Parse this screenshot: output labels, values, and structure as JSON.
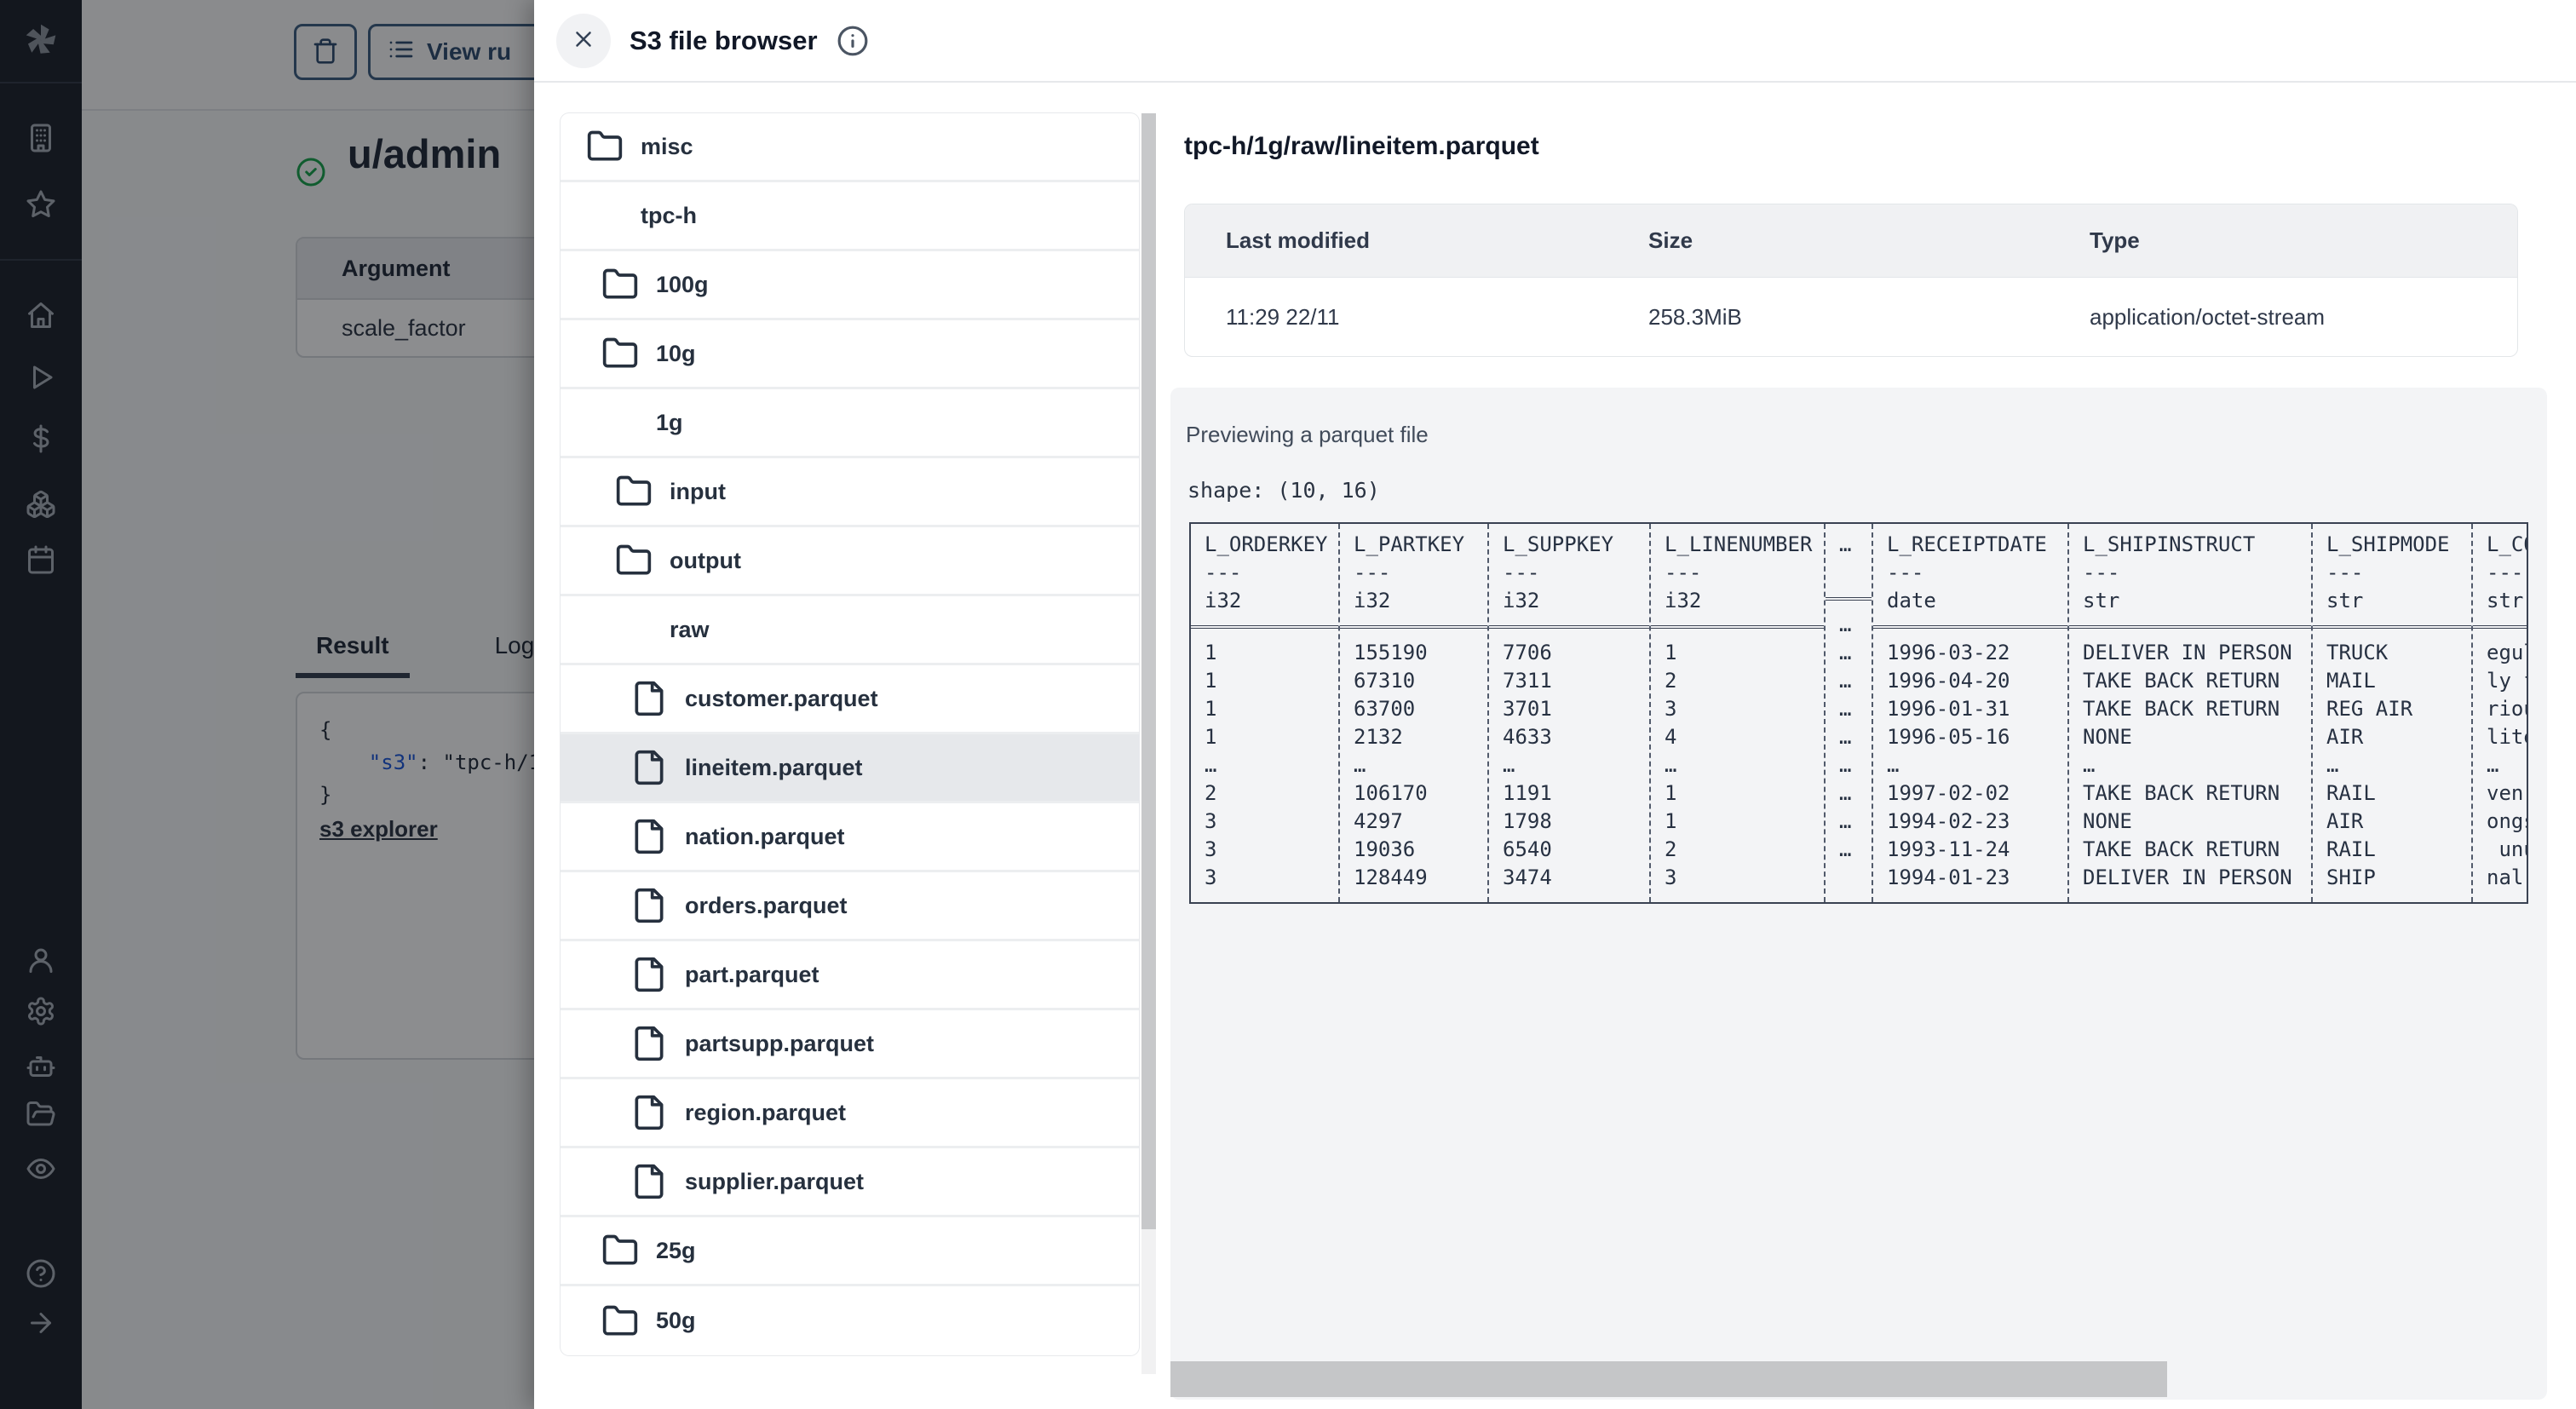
{
  "sidebar": {
    "icons": [
      "windmill-logo",
      "building-icon",
      "star-icon",
      "home-icon",
      "play-icon",
      "dollar-icon",
      "boxes-icon",
      "calendar-icon",
      "user-icon",
      "gear-icon",
      "robot-icon",
      "folder-open-icon",
      "eye-icon",
      "help-icon",
      "arrow-right-icon"
    ]
  },
  "page": {
    "view_runs_label": "View ru",
    "title": "u/admin",
    "arg_table": {
      "header": "Argument",
      "rows": [
        "scale_factor"
      ]
    },
    "tabs": {
      "result": "Result",
      "logs": "Logs"
    },
    "code": {
      "line_open": "{",
      "key": "\"s3\"",
      "sep": ": ",
      "value": "\"tpc-h/1",
      "line_close": "}",
      "link": "s3 explorer"
    }
  },
  "modal": {
    "title": "S3 file browser",
    "tree": {
      "items": [
        {
          "label": "misc",
          "icon": "folder",
          "level": 0,
          "selected": false
        },
        {
          "label": "tpc-h",
          "icon": "folder-open",
          "level": 0,
          "selected": false
        },
        {
          "label": "100g",
          "icon": "folder",
          "level": 1,
          "selected": false
        },
        {
          "label": "10g",
          "icon": "folder",
          "level": 1,
          "selected": false
        },
        {
          "label": "1g",
          "icon": "folder-open",
          "level": 1,
          "selected": false
        },
        {
          "label": "input",
          "icon": "folder",
          "level": 2,
          "selected": false
        },
        {
          "label": "output",
          "icon": "folder",
          "level": 2,
          "selected": false
        },
        {
          "label": "raw",
          "icon": "folder-open",
          "level": 2,
          "selected": false
        },
        {
          "label": "customer.parquet",
          "icon": "file",
          "level": 3,
          "selected": false
        },
        {
          "label": "lineitem.parquet",
          "icon": "file",
          "level": 3,
          "selected": true
        },
        {
          "label": "nation.parquet",
          "icon": "file",
          "level": 3,
          "selected": false
        },
        {
          "label": "orders.parquet",
          "icon": "file",
          "level": 3,
          "selected": false
        },
        {
          "label": "part.parquet",
          "icon": "file",
          "level": 3,
          "selected": false
        },
        {
          "label": "partsupp.parquet",
          "icon": "file",
          "level": 3,
          "selected": false
        },
        {
          "label": "region.parquet",
          "icon": "file",
          "level": 3,
          "selected": false
        },
        {
          "label": "supplier.parquet",
          "icon": "file",
          "level": 3,
          "selected": false
        },
        {
          "label": "25g",
          "icon": "folder",
          "level": 1,
          "selected": false
        },
        {
          "label": "50g",
          "icon": "folder",
          "level": 1,
          "selected": false
        }
      ]
    },
    "detail": {
      "path": "tpc-h/1g/raw/lineitem.parquet",
      "meta_headers": [
        "Last modified",
        "Size",
        "Type"
      ],
      "meta_values": [
        "11:29 22/11",
        "258.3MiB",
        "application/octet-stream"
      ],
      "preview_label": "Previewing a parquet file",
      "shape": "shape: (10, 16)"
    }
  },
  "preview_table": {
    "type": "table",
    "columns": [
      {
        "name": "L_ORDERKEY",
        "sep": "---",
        "dtype": "i32",
        "values": [
          "1",
          "1",
          "1",
          "1",
          "…",
          "2",
          "3",
          "3",
          "3"
        ]
      },
      {
        "name": "L_PARTKEY",
        "sep": "---",
        "dtype": "i32",
        "values": [
          "155190",
          "67310",
          "63700",
          "2132",
          "…",
          "106170",
          "4297",
          "19036",
          "128449"
        ]
      },
      {
        "name": "L_SUPPKEY",
        "sep": "---",
        "dtype": "i32",
        "values": [
          "7706",
          "7311",
          "3701",
          "4633",
          "…",
          "1191",
          "1798",
          "6540",
          "3474"
        ]
      },
      {
        "name": "L_LINENUMBER",
        "sep": "---",
        "dtype": "i32",
        "values": [
          "1",
          "2",
          "3",
          "4",
          "…",
          "1",
          "1",
          "2",
          "3"
        ]
      },
      {
        "name": "…",
        "sep": "",
        "dtype": "",
        "values": [
          "…",
          "…",
          "…",
          "…",
          "…",
          "…",
          "…",
          "…",
          "…"
        ]
      },
      {
        "name": "L_RECEIPTDATE",
        "sep": "---",
        "dtype": "date",
        "values": [
          "1996-03-22",
          "1996-04-20",
          "1996-01-31",
          "1996-05-16",
          "…",
          "1997-02-02",
          "1994-02-23",
          "1993-11-24",
          "1994-01-23"
        ]
      },
      {
        "name": "L_SHIPINSTRUCT",
        "sep": "---",
        "dtype": "str",
        "values": [
          "DELIVER IN PERSON",
          "TAKE BACK RETURN",
          "TAKE BACK RETURN",
          "NONE",
          "…",
          "TAKE BACK RETURN",
          "NONE",
          "TAKE BACK RETURN",
          "DELIVER IN PERSON"
        ]
      },
      {
        "name": "L_SHIPMODE",
        "sep": "---",
        "dtype": "str",
        "values": [
          "TRUCK",
          "MAIL",
          "REG AIR",
          "AIR",
          "…",
          "RAIL",
          "AIR",
          "RAIL",
          "SHIP"
        ]
      },
      {
        "name": "L_CO",
        "sep": "---",
        "dtype": "str",
        "values": [
          "egul",
          "ly f",
          "riou",
          "lite",
          "…",
          "ven",
          "ongs",
          " unu",
          "nal"
        ]
      }
    ]
  }
}
